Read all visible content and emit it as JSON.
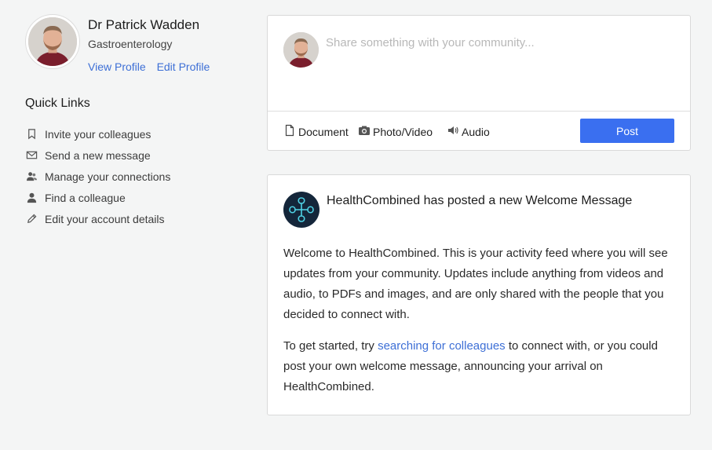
{
  "profile": {
    "name": "Dr Patrick Wadden",
    "specialty": "Gastroenterology",
    "view_profile": "View Profile",
    "edit_profile": "Edit Profile"
  },
  "quick_links": {
    "title": "Quick Links",
    "items": [
      {
        "label": "Invite your colleagues",
        "icon": "bookmark-icon"
      },
      {
        "label": "Send a new message",
        "icon": "envelope-icon"
      },
      {
        "label": "Manage your connections",
        "icon": "users-icon"
      },
      {
        "label": "Find a colleague",
        "icon": "user-icon"
      },
      {
        "label": "Edit your account details",
        "icon": "pencil-icon"
      }
    ]
  },
  "composer": {
    "placeholder": "Share something with your community...",
    "attachments": {
      "document": "Document",
      "photo_video": "Photo/Video",
      "audio": "Audio"
    },
    "post_label": "Post"
  },
  "post": {
    "author": "HealthCombined",
    "action": "has posted a new",
    "subject": "Welcome Message",
    "paragraph1": "Welcome to HealthCombined. This is your activity feed where you will see updates from your community. Updates include anything from videos and audio, to PDFs and images, and are only shared with the people that you decided to connect with.",
    "paragraph2_before": "To get started, try",
    "paragraph2_link": "searching for colleagues",
    "paragraph2_after": "to connect with, or you could post your own welcome message, announcing your arrival on HealthCombined."
  },
  "colors": {
    "accent": "#3a6ff0",
    "link": "#3d6fd6",
    "background": "#f4f5f5",
    "logo_bg": "#14263a",
    "logo_fg": "#4fd3e6"
  }
}
